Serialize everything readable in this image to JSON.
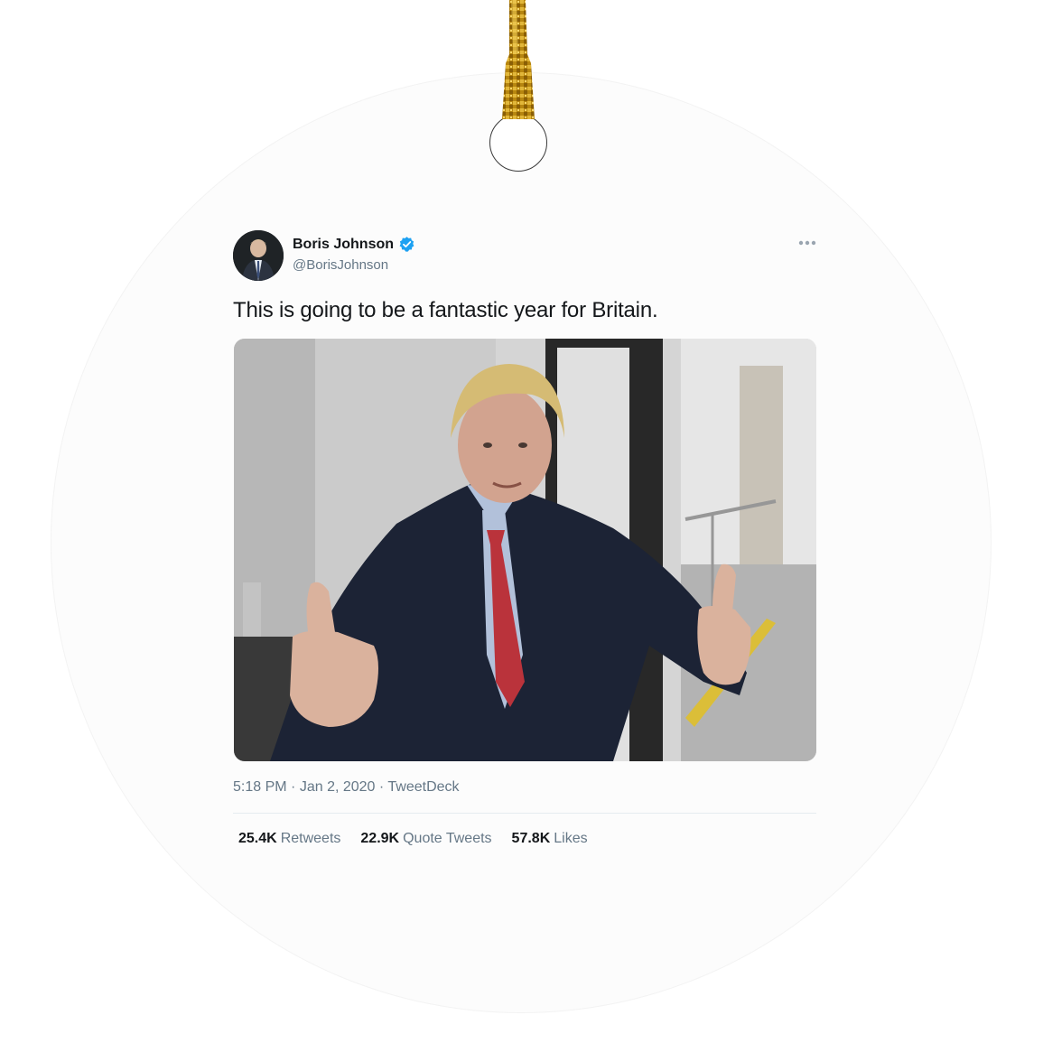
{
  "tweet": {
    "display_name": "Boris Johnson",
    "handle": "@BorisJohnson",
    "text": "This is going to be a fantastic year for Britain.",
    "time": "5:18 PM",
    "date": "Jan 2, 2020",
    "source": "TweetDeck",
    "separator": "·",
    "verified_color": "#1da1f2",
    "stats": [
      {
        "count": "25.4K",
        "label": "Retweets"
      },
      {
        "count": "22.9K",
        "label": "Quote Tweets"
      },
      {
        "count": "57.8K",
        "label": "Likes"
      }
    ]
  },
  "icons": {
    "verified": "verified-badge-icon",
    "more": "more-options-icon"
  },
  "colors": {
    "ribbon": "#c9961c",
    "ornament": "#fcfcfc"
  }
}
